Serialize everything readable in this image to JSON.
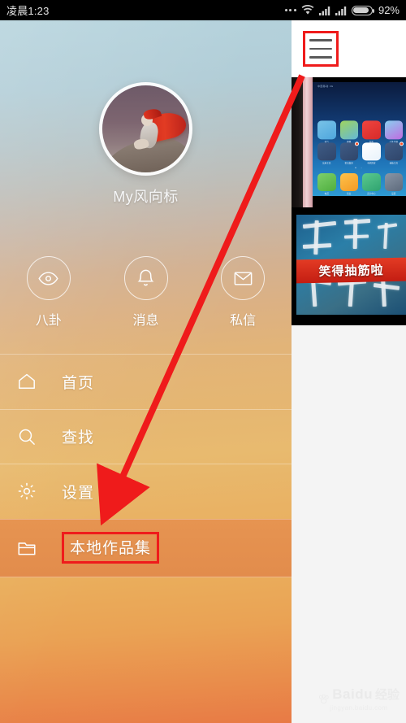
{
  "status_bar": {
    "time": "凌晨1:23",
    "battery_percent": "92%",
    "icons": [
      "more-dots-icon",
      "wifi-icon",
      "signal-icon-1",
      "signal-icon-2",
      "battery-icon"
    ]
  },
  "drawer": {
    "profile": {
      "avatar_name": "user-avatar",
      "username": "My风向标"
    },
    "quick_actions": [
      {
        "label": "八卦",
        "icon": "eye-icon"
      },
      {
        "label": "消息",
        "icon": "bell-icon"
      },
      {
        "label": "私信",
        "icon": "envelope-icon"
      }
    ],
    "menu_items": [
      {
        "label": "首页",
        "icon": "home-icon",
        "active": false
      },
      {
        "label": "查找",
        "icon": "search-icon",
        "active": false
      },
      {
        "label": "设置",
        "icon": "gear-icon",
        "active": false
      },
      {
        "label": "本地作品集",
        "icon": "folder-icon",
        "active": true
      }
    ]
  },
  "right_panel": {
    "header": {
      "menu_icon": "hamburger-icon"
    },
    "thumbnails": [
      {
        "name": "phone-homescreen-thumbnail",
        "caption_status": "中国移动 4G",
        "app_icons": [
          {
            "label": "天气",
            "color1": "#79c3e8",
            "color2": "#4ea6dd"
          },
          {
            "label": "相册",
            "color1": "#9fd45e",
            "color2": "#63b8d8"
          },
          {
            "label": "音乐",
            "color1": "#f0453f",
            "color2": "#d72a2a"
          },
          {
            "label": "个性主题",
            "color1": "#8ad0f0",
            "color2": "#c06be0"
          },
          {
            "label": "实用工具",
            "color1": "#3f5c86",
            "color2": "#2f456a"
          },
          {
            "label": "影音娱乐",
            "color1": "#3f5c86",
            "color2": "#2f456a"
          },
          {
            "label": "手机管家",
            "color1": "#ffffff",
            "color2": "#e8f2fb"
          },
          {
            "label": "系统工具",
            "color1": "#3f5c86",
            "color2": "#2f456a"
          }
        ],
        "dock_icons": [
          {
            "label": "电话",
            "color1": "#7ed06a",
            "color2": "#4fae3f"
          },
          {
            "label": "短信",
            "color1": "#ffc24a",
            "color2": "#f39a25"
          },
          {
            "label": "安全中心",
            "color1": "#5bc98f",
            "color2": "#2fa370"
          },
          {
            "label": "设置",
            "color1": "#8a96a6",
            "color2": "#5d6a7c"
          }
        ],
        "page_dots": "• ·"
      },
      {
        "name": "calligraphy-video-thumbnail",
        "banner_text": "笑得抽筋啦"
      }
    ]
  },
  "annotations": {
    "hamburger_highlight": {
      "name": "red-box-hamburger",
      "color": "#ef1b1b"
    },
    "arrow": {
      "name": "red-arrow",
      "color": "#ef1b1b",
      "from": "hamburger-icon",
      "to": "本地作品集"
    },
    "menu_highlight": {
      "name": "red-box-local-collection",
      "color": "#ef1b1b"
    }
  },
  "watermark": {
    "brand_en": "Baidu",
    "brand_cn": "经验",
    "url": "jingyan.baidu.com"
  }
}
